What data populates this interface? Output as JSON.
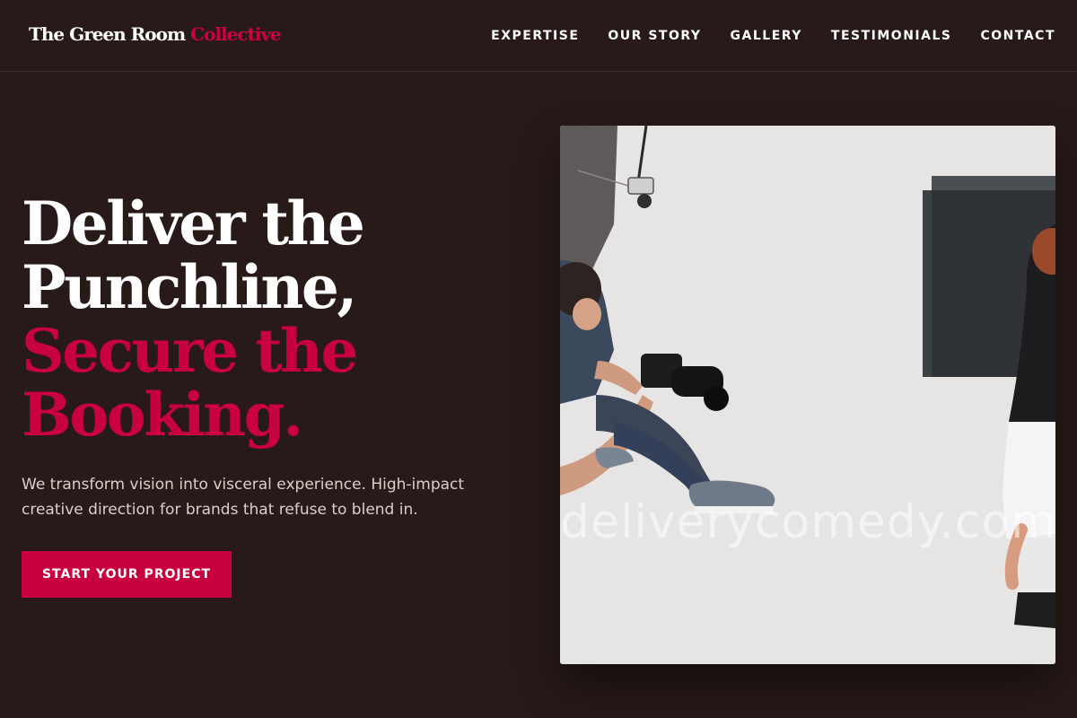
{
  "brand": {
    "name": "The Green Room",
    "accent": "Collective"
  },
  "nav": {
    "items": [
      "EXPERTISE",
      "OUR STORY",
      "GALLERY",
      "TESTIMONIALS",
      "CONTACT"
    ]
  },
  "hero": {
    "headline_line1": "Deliver the",
    "headline_line2": "Punchline,",
    "headline_line3": "Secure the",
    "headline_line4": "Booking.",
    "subtext": "We transform vision into visceral experience. High-impact creative direction for brands that refuse to blend in.",
    "cta_label": "START YOUR PROJECT",
    "watermark": "deliverycomedy.com"
  },
  "colors": {
    "background": "#271a18",
    "accent": "#c8003f",
    "text": "#ffffff"
  }
}
